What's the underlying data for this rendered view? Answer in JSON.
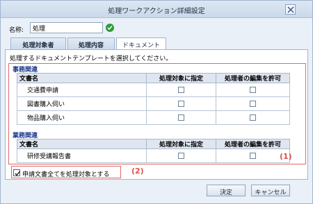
{
  "window": {
    "title": "処理ワークアクション詳細設定"
  },
  "name": {
    "label": "名称:",
    "value": "処理"
  },
  "tabs": [
    {
      "label": "処理対象者"
    },
    {
      "label": "処理内容"
    },
    {
      "label": "ドキュメント"
    }
  ],
  "panel": {
    "instruction": "処理するドキュメントテンプレートを選択してください。"
  },
  "columns": {
    "doc": "文書名",
    "target": "処理対象に指定",
    "editor": "処理者の編集を許可"
  },
  "sections": [
    {
      "title": "事務関連",
      "rows": [
        {
          "name": "交通費申請",
          "target": false,
          "editor": false
        },
        {
          "name": "図書購入伺い",
          "target": false,
          "editor": false
        },
        {
          "name": "物品購入伺い",
          "target": false,
          "editor": false
        }
      ]
    },
    {
      "title": "業務関連",
      "rows": [
        {
          "name": "研修受講報告書",
          "target": false,
          "editor": false
        }
      ]
    }
  ],
  "annotations": {
    "one": "(1)",
    "two": "(2)"
  },
  "all_docs": {
    "label": "申請文書全てを処理対象とする",
    "checked": true
  },
  "buttons": {
    "ok": "決定",
    "cancel": "キャンセル"
  },
  "colors": {
    "annotation": "#e06868",
    "section_title": "#1a3a8c",
    "check": "#2e9d3a"
  }
}
